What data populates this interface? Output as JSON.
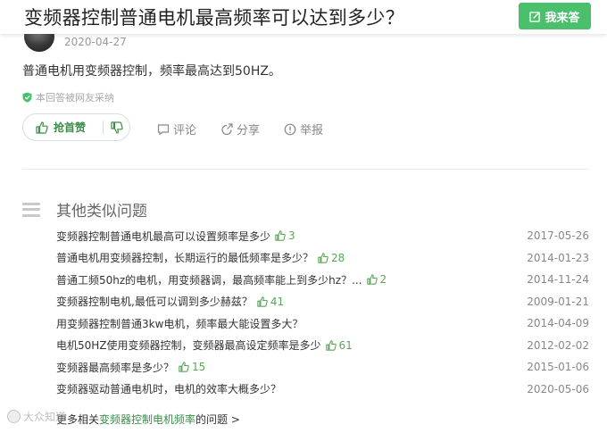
{
  "header": {
    "question_title": "变频器控制普通电机最高频率可以达到多少？",
    "answer_button": "我来答"
  },
  "answer": {
    "date": "2020-04-27",
    "text": "普通电机用变频器控制，频率最高达到50HZ。",
    "verified_note": "本回答被网友采纳",
    "vote_up_label": "抢首赞",
    "actions": {
      "comment": "评论",
      "share": "分享",
      "report": "举报"
    }
  },
  "similar": {
    "section_title": "其他类似问题",
    "items": [
      {
        "text": "变频器控制普通电机最高可以设置频率是多少",
        "likes": "3",
        "date": "2017-05-26"
      },
      {
        "text": "普通电机用变频器控制，长期运行的最低频率是多少？",
        "likes": "28",
        "date": "2014-01-23"
      },
      {
        "text": "普通工频50hz的电机，用变频器调，最高频率能上到多少hz？...",
        "likes": "2",
        "date": "2014-11-24"
      },
      {
        "text": "变频器控制电机,最低可以调到多少赫兹？",
        "likes": "41",
        "date": "2009-01-21"
      },
      {
        "text": "用变频器控制普通3kw电机，频率最大能设置多大？",
        "likes": "",
        "date": "2014-04-09"
      },
      {
        "text": "电机50HZ使用变频器控制，变频器最高设定频率是多少",
        "likes": "61",
        "date": "2012-02-02"
      },
      {
        "text": "变频器最高频率是多少？",
        "likes": "15",
        "date": "2015-01-06"
      },
      {
        "text": "变频器驱动普通电机时，电机的效率大概多少？",
        "likes": "",
        "date": "2020-05-06"
      }
    ],
    "more": {
      "prefix": "更多相关",
      "link": "变频器控制电机频率",
      "suffix": "的问题 >"
    }
  },
  "watermark": {
    "text": "大众知道"
  },
  "colors": {
    "brand_green": "#4bc06c",
    "like_green": "#5aa55a",
    "link_green": "#3a8c49"
  }
}
